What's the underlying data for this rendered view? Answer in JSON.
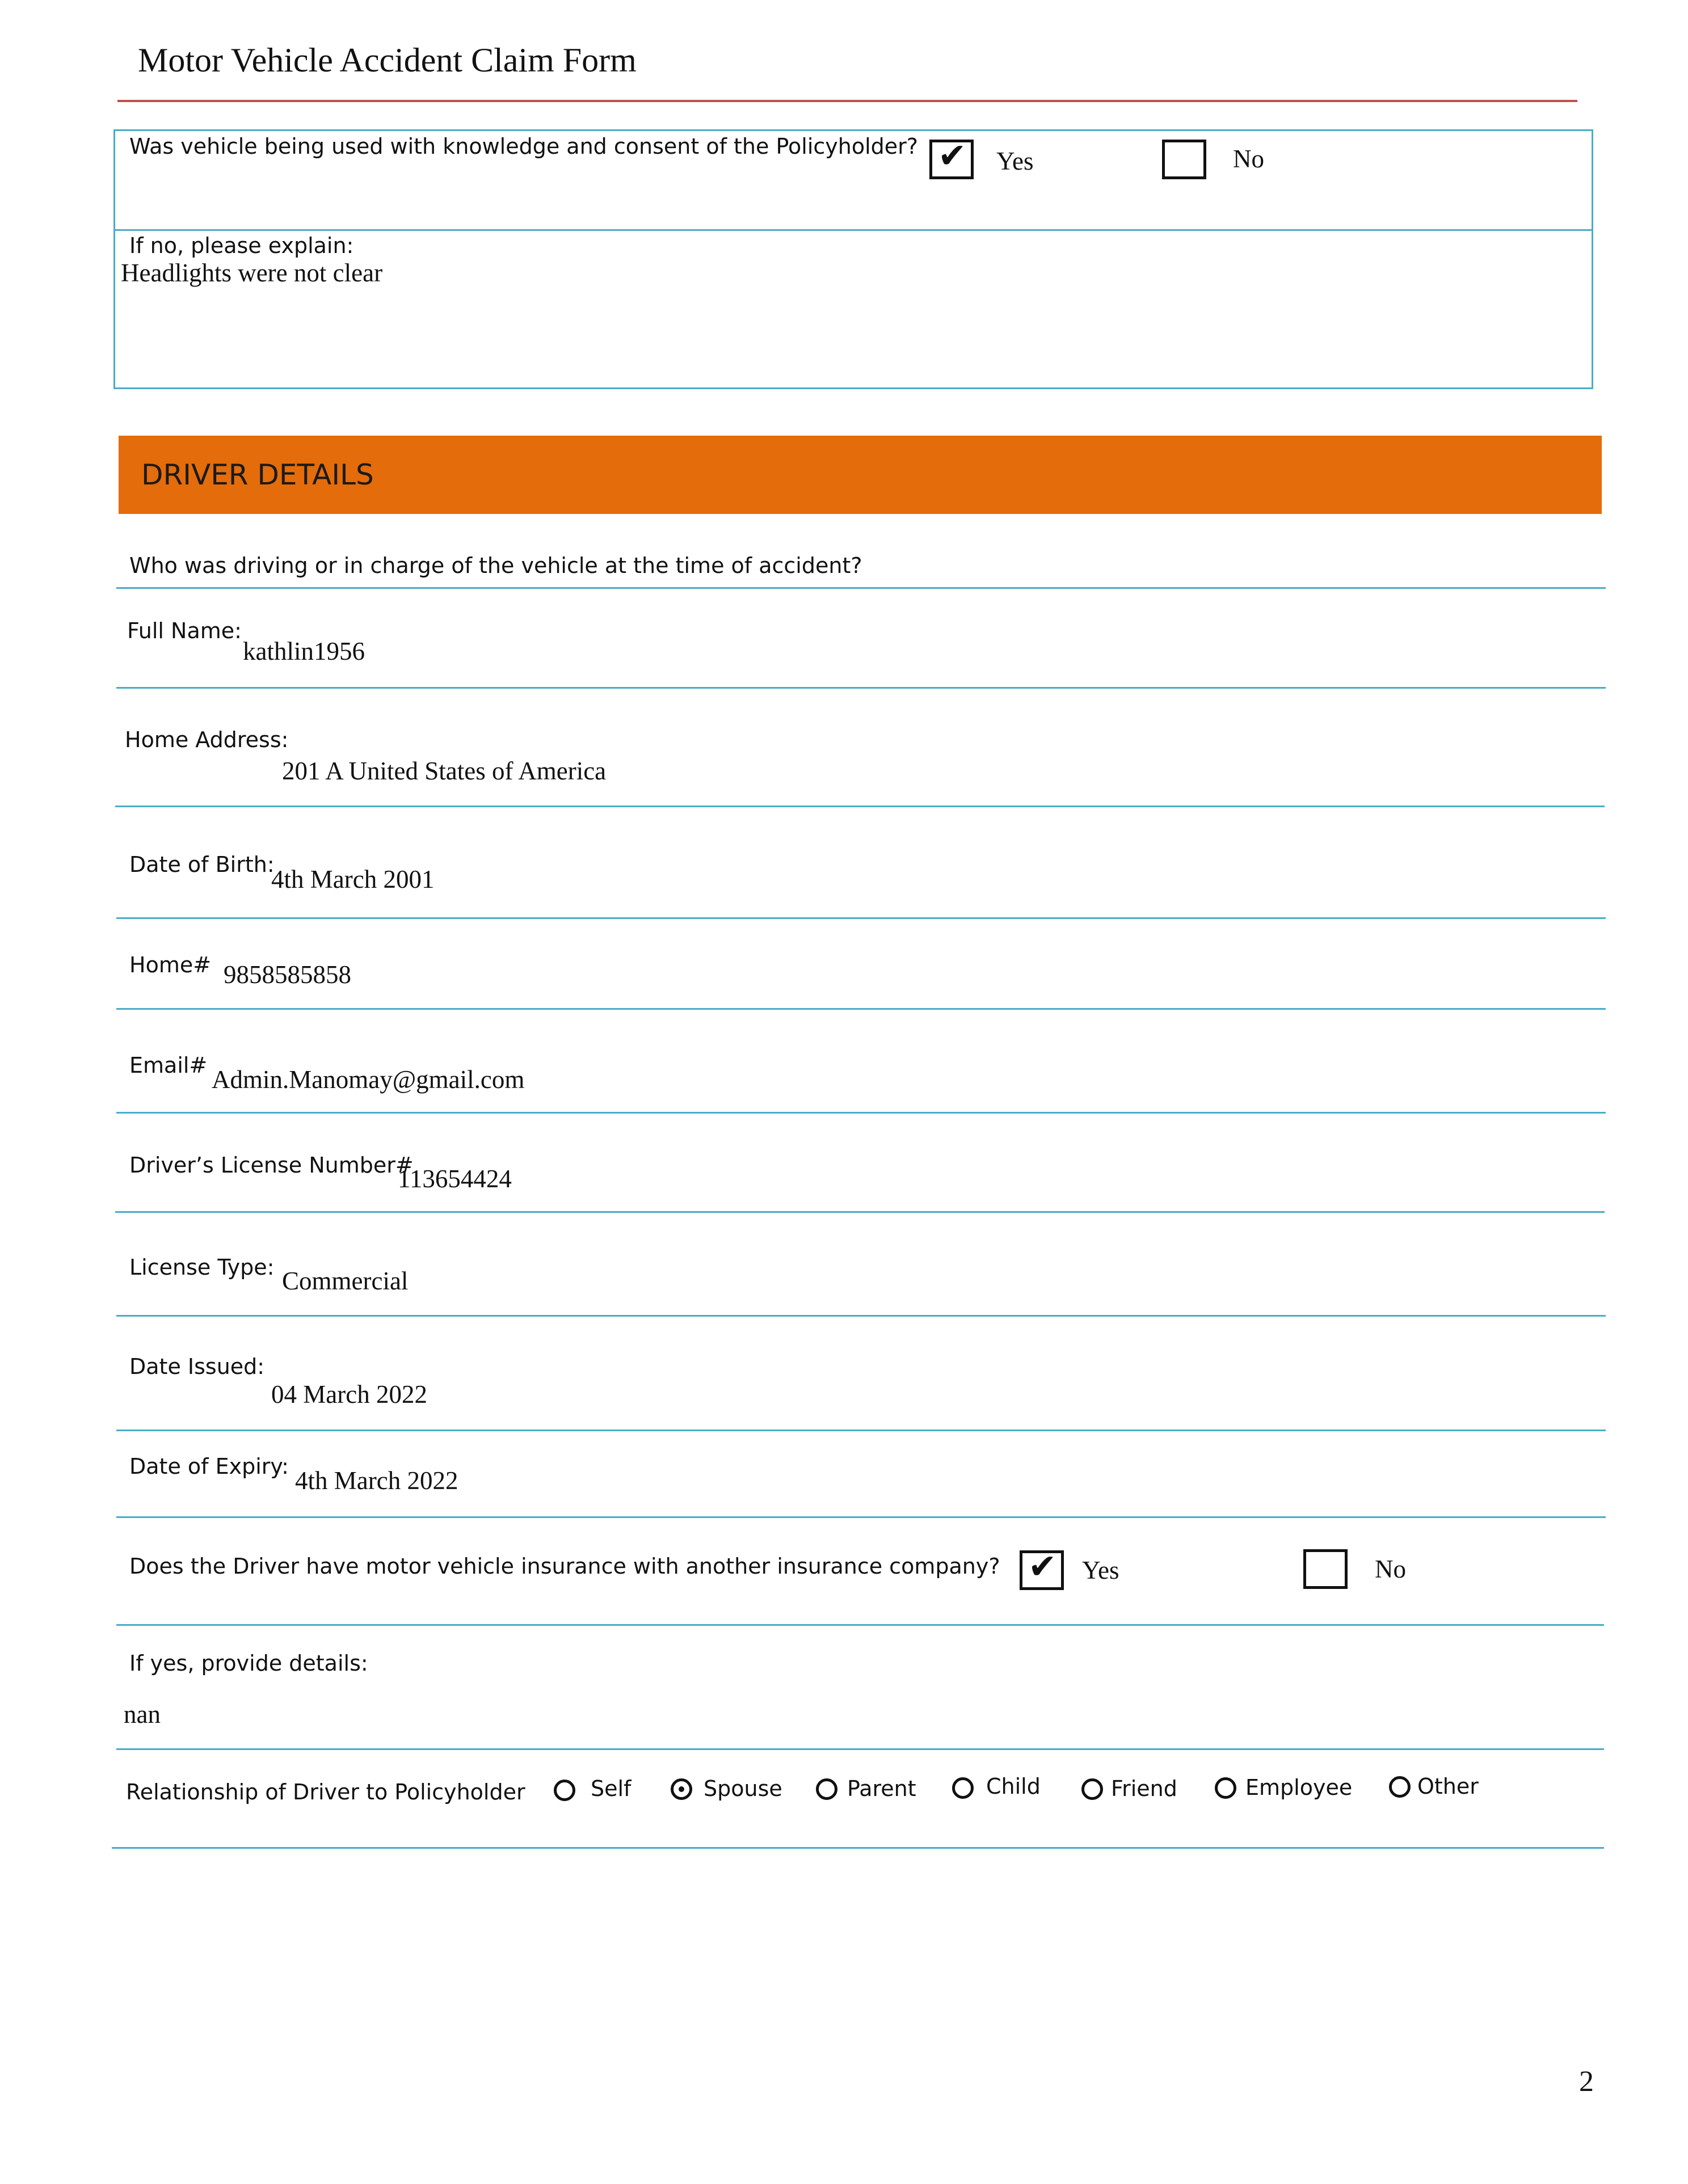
{
  "header": {
    "title": "Motor Vehicle Accident Claim Form"
  },
  "consent": {
    "question": "Was vehicle being used with knowledge and consent of the Policyholder?",
    "yes_label": "Yes",
    "yes_checked": true,
    "no_label": "No",
    "no_checked": false,
    "explain_label": "If no, please explain:",
    "explain_value": "Headlights were not clear"
  },
  "driver_section": {
    "heading": "DRIVER DETAILS",
    "intro": "Who was driving or in charge of the vehicle at the time of accident?",
    "fields": {
      "full_name": {
        "label": "Full Name:",
        "value": "kathlin1956"
      },
      "home_address": {
        "label": "Home Address:",
        "value": "201 A United States of America"
      },
      "dob": {
        "label": "Date of Birth:",
        "value": "4th March 2001"
      },
      "home_phone": {
        "label": "Home#",
        "value": "9858585858"
      },
      "email": {
        "label": "Email#",
        "value": "Admin.Manomay@gmail.com"
      },
      "license_number": {
        "label": "Driver’s License Number#",
        "value": "113654424"
      },
      "license_type": {
        "label": "License Type:",
        "value": "Commercial"
      },
      "date_issued": {
        "label": "Date Issued:",
        "value": "04 March 2022"
      },
      "date_expiry": {
        "label": "Date of Expiry:",
        "value": "4th March 2022"
      }
    },
    "other_insurance": {
      "question": "Does the Driver have motor vehicle insurance with another insurance company?",
      "yes_label": "Yes",
      "yes_checked": true,
      "no_label": "No",
      "no_checked": false
    },
    "details": {
      "label": "If yes, provide details:",
      "value": "nan"
    },
    "relationship": {
      "label": "Relationship of Driver to Policyholder",
      "options": [
        "Self",
        "Spouse",
        "Parent",
        "Child",
        "Friend",
        "Employee",
        "Other"
      ],
      "selected": "Spouse"
    }
  },
  "footer": {
    "page_number": "2"
  },
  "colors": {
    "accent_orange": "#e46c0a",
    "rule_blue": "#4bacc6",
    "title_rule_red": "#c0504d"
  },
  "icons": {
    "checked": "check-mark-icon",
    "radio": "radio-icon"
  }
}
